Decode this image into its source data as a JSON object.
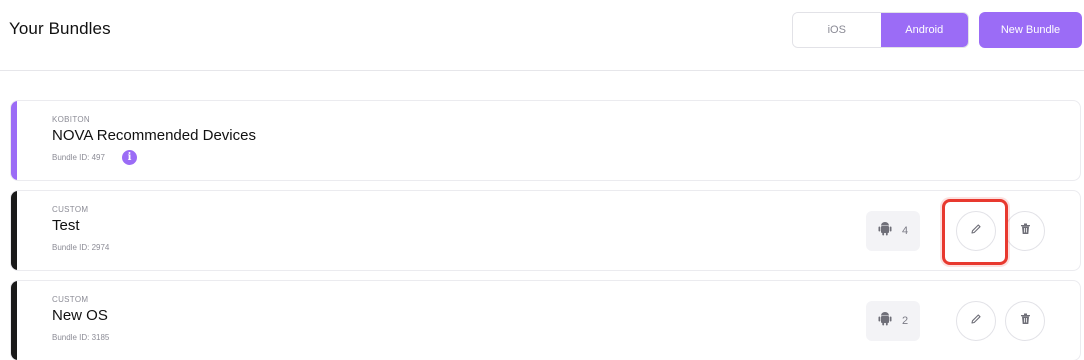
{
  "header": {
    "title": "Your Bundles",
    "os_toggle": {
      "ios_label": "iOS",
      "android_label": "Android",
      "selected": "Android"
    },
    "new_bundle_label": "New Bundle"
  },
  "colors": {
    "accent": "#9b6cf6",
    "custom_accent": "#1a1a1a",
    "highlight": "#e8392f"
  },
  "bundles": [
    {
      "type": "KOBITON",
      "name": "NOVA Recommended Devices",
      "bundle_id": "Bundle ID: 497",
      "icon": "info-icon"
    },
    {
      "type": "CUSTOM",
      "name": "Test",
      "bundle_id": "Bundle ID: 2974",
      "device_count": "4",
      "platform_icon": "android-icon",
      "edit_icon": "pencil-icon",
      "delete_icon": "trash-icon"
    },
    {
      "type": "CUSTOM",
      "name": "New OS",
      "bundle_id": "Bundle ID: 3185",
      "device_count": "2",
      "platform_icon": "android-icon",
      "edit_icon": "pencil-icon",
      "delete_icon": "trash-icon"
    }
  ]
}
